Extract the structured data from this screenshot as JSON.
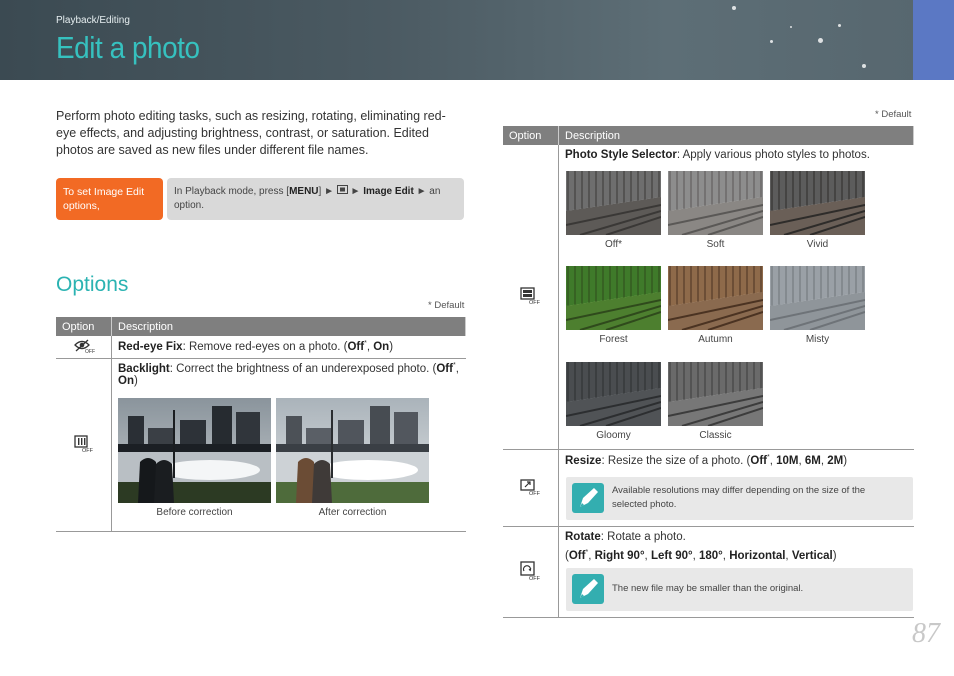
{
  "header": {
    "breadcrumb": "Playback/Editing",
    "title": "Edit a photo"
  },
  "intro": "Perform photo editing tasks, such as resizing, rotating, eliminating red-eye effects, and adjusting brightness, contrast, or saturation. Edited photos are saved as new files under different file names.",
  "howto": {
    "label": "To set Image Edit options,",
    "steps_pre": "In Playback mode, press [",
    "menu_key": "MENU",
    "steps_mid": "] ► ",
    "steps_arrow": " ► ",
    "image_edit": "Image Edit",
    "steps_post": " ► an option."
  },
  "section_title": "Options",
  "default_note": "* Default",
  "table_headers": {
    "option": "Option",
    "description": "Description"
  },
  "left_rows": {
    "redeye": {
      "name": "Red-eye Fix",
      "desc": ": Remove red-eyes on a photo. (",
      "off": "Off",
      "star": "*",
      "sep": ", ",
      "on": "On",
      "close": ")"
    },
    "backlight": {
      "name": "Backlight",
      "desc": ": Correct the brightness of an underexposed photo. (",
      "off": "Off",
      "star": "*",
      "sep": ", ",
      "on": "On",
      "close": ")",
      "before": "Before correction",
      "after": "After correction"
    }
  },
  "right_rows": {
    "style": {
      "name": "Photo Style Selector",
      "desc": ": Apply various photo styles to photos.",
      "styles": [
        "Off*",
        "Soft",
        "Vivid",
        "Forest",
        "Autumn",
        "Misty",
        "Gloomy",
        "Classic"
      ]
    },
    "resize": {
      "name": "Resize",
      "desc": ": Resize the size of a photo. (",
      "off": "Off",
      "star": "*",
      "sep": ", ",
      "o1": "10M",
      "o2": "6M",
      "o3": "2M",
      "close": ")",
      "note": "Available resolutions may differ depending on the size of the selected photo."
    },
    "rotate": {
      "name": "Rotate",
      "desc": ": Rotate a photo.",
      "open": "(",
      "off": "Off",
      "star": "*",
      "sep": ", ",
      "o1": "Right 90°",
      "o2": "Left 90°",
      "o3": "180°",
      "o4": "Horizontal",
      "o5": "Vertical",
      "close": ")",
      "note": "The new file may be smaller than the original."
    }
  },
  "page_number": "87",
  "colors": {
    "accent": "#36c1bf",
    "orange": "#f26a24",
    "header_bg": "#4b5a62",
    "tab": "#5b78c4"
  }
}
